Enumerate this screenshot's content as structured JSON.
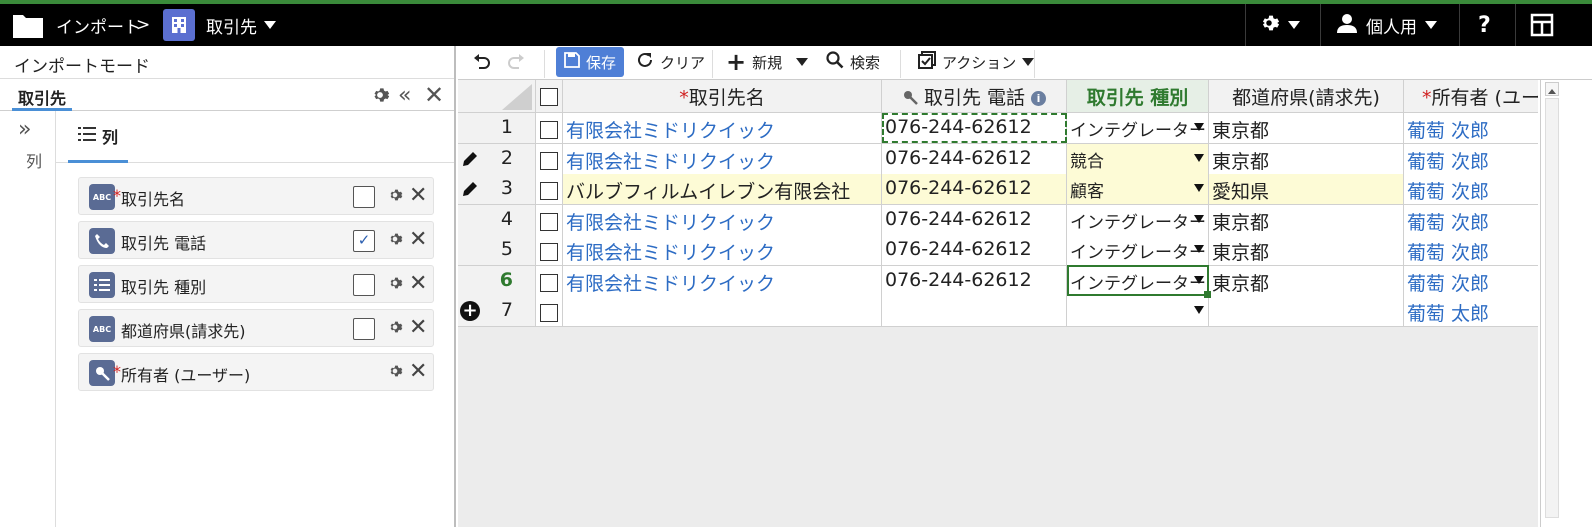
{
  "topbar": {
    "breadcrumb_root": "インポート",
    "breadcrumb_sep": ">",
    "object_name": "取引先",
    "user_label": "個人用",
    "help_label": "?"
  },
  "left_panel": {
    "mode_title": "インポートモード",
    "object_tab": "取引先",
    "side_label": "列",
    "columns_tab": "列",
    "columns": [
      {
        "icon": "text-icon",
        "icon_text": "ABC",
        "required": true,
        "label": "取引先名",
        "checked": false
      },
      {
        "icon": "phone-icon",
        "icon_text": "",
        "required": false,
        "label": "取引先 電話",
        "checked": true
      },
      {
        "icon": "picklist-icon",
        "icon_text": "",
        "required": false,
        "label": "取引先 種別",
        "checked": false
      },
      {
        "icon": "text-icon",
        "icon_text": "ABC",
        "required": false,
        "label": "都道府県(請求先)",
        "checked": false
      },
      {
        "icon": "lookup-icon",
        "icon_text": "",
        "required": true,
        "label": "所有者 (ユーザー)",
        "checked": null
      }
    ]
  },
  "toolbar": {
    "save": "保存",
    "clear": "クリア",
    "new": "新規",
    "search": "検索",
    "action": "アクション"
  },
  "grid": {
    "headers": {
      "name": "取引先名",
      "phone": "取引先 電話",
      "type": "取引先 種別",
      "pref": "都道府県(請求先)",
      "owner": "所有者 (ユー"
    },
    "rows": [
      {
        "num": "1",
        "name": "有限会社ミドリクイック",
        "phone": "076-244-62612",
        "type": "インテグレーター",
        "pref": "東京都",
        "owner": "葡萄 次郎",
        "edited": false
      },
      {
        "num": "2",
        "name": "有限会社ミドリクイック",
        "phone": "076-244-62612",
        "type": "競合",
        "pref": "東京都",
        "owner": "葡萄 次郎",
        "edited": true
      },
      {
        "num": "3",
        "name": "バルブフィルムイレブン有限会社",
        "phone": "076-244-62612",
        "type": "顧客",
        "pref": "愛知県",
        "owner": "葡萄 次郎",
        "edited": true
      },
      {
        "num": "4",
        "name": "有限会社ミドリクイック",
        "phone": "076-244-62612",
        "type": "インテグレーター",
        "pref": "東京都",
        "owner": "葡萄 次郎",
        "edited": false
      },
      {
        "num": "5",
        "name": "有限会社ミドリクイック",
        "phone": "076-244-62612",
        "type": "インテグレーター",
        "pref": "東京都",
        "owner": "葡萄 次郎",
        "edited": false
      },
      {
        "num": "6",
        "name": "有限会社ミドリクイック",
        "phone": "076-244-62612",
        "type": "インテグレーター",
        "pref": "東京都",
        "owner": "葡萄 次郎",
        "edited": false
      },
      {
        "num": "7",
        "name": "",
        "phone": "",
        "type": "",
        "pref": "",
        "owner": "葡萄 太郎",
        "edited": false
      }
    ]
  },
  "colors": {
    "accent": "#4f7fd6",
    "link": "#2d6cc4",
    "highlight": "#fdfbd6",
    "active_green": "#2f7a2f"
  }
}
